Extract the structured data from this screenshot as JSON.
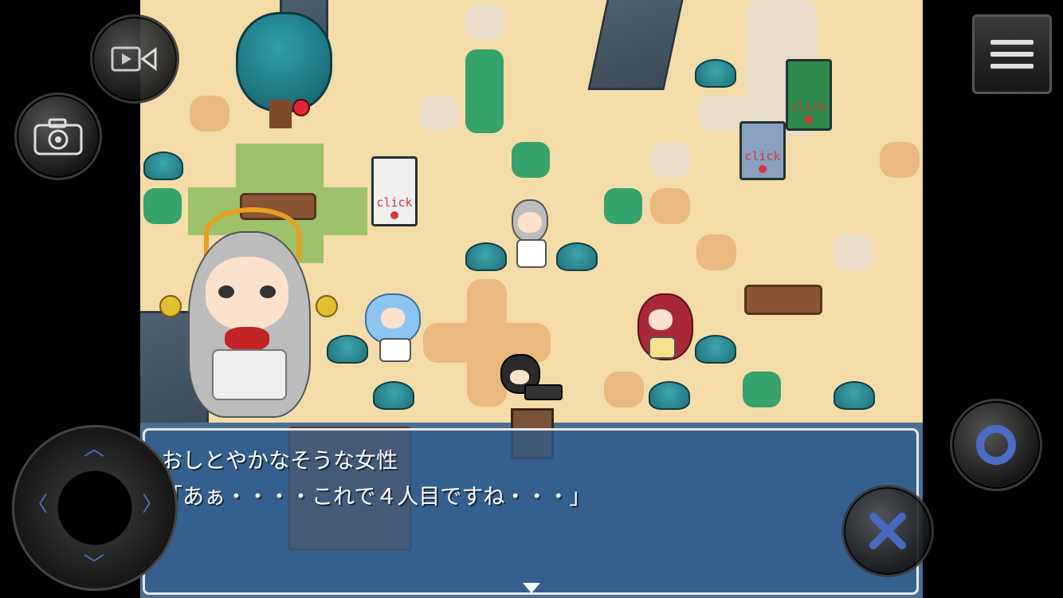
{
  "dialog": {
    "speaker": "おしとやかなそうな女性",
    "message": "「あぁ・・・・これで４人目ですね・・・」"
  },
  "map_signs": [
    {
      "label": "click"
    },
    {
      "label": "click"
    },
    {
      "label": "click"
    }
  ],
  "controls": {
    "record_icon": "video-record-icon",
    "screenshot_icon": "camera-icon",
    "menu_icon": "hamburger-menu-icon",
    "confirm_icon": "circle-confirm-icon",
    "cancel_icon": "x-cancel-icon",
    "dpad_icon": "dpad-arrows-icon"
  },
  "colors": {
    "sand": "#f3dca7",
    "dialog_bg": "#305c8c",
    "sign_text": "#d63737",
    "button_accent": "#4a6cc5"
  }
}
